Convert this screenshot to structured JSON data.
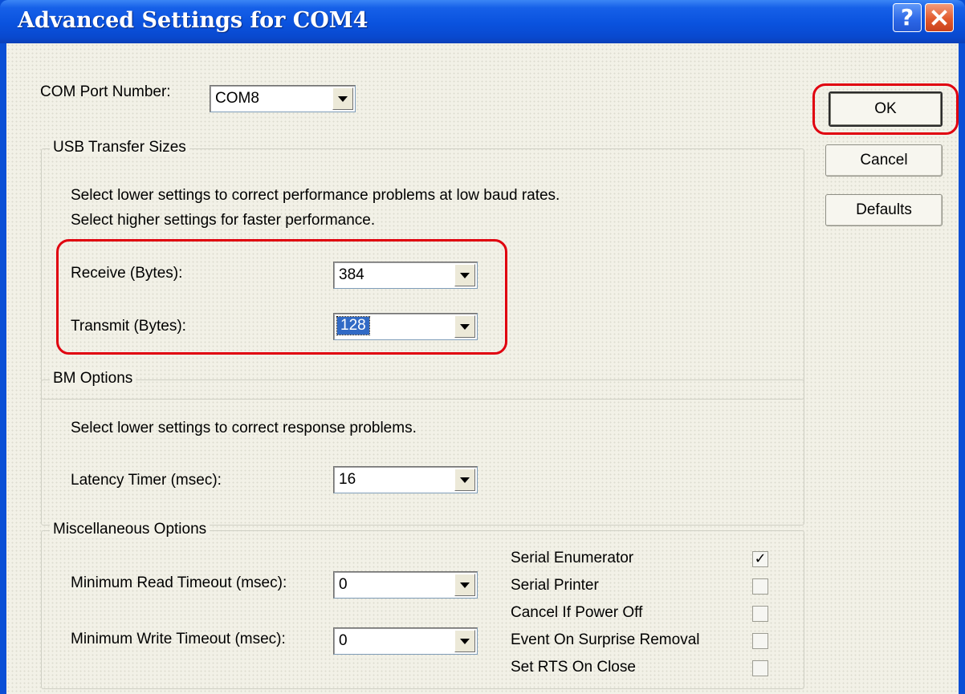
{
  "window": {
    "title": "Advanced Settings for COM4"
  },
  "com_port": {
    "label": "COM Port Number:",
    "value": "COM8"
  },
  "buttons": {
    "ok": "OK",
    "cancel": "Cancel",
    "defaults": "Defaults"
  },
  "usb_transfer": {
    "group_title": "USB Transfer Sizes",
    "hint_line1": "Select lower settings to correct performance problems at low baud rates.",
    "hint_line2": "Select higher settings for faster performance.",
    "receive_label": "Receive (Bytes):",
    "receive_value": "384",
    "transmit_label": "Transmit (Bytes):",
    "transmit_value": "128"
  },
  "bm_options": {
    "group_title": "BM Options",
    "hint": "Select lower settings to correct response problems.",
    "latency_label": "Latency Timer (msec):",
    "latency_value": "16"
  },
  "misc_options": {
    "group_title": "Miscellaneous Options",
    "min_read_label": "Minimum Read Timeout (msec):",
    "min_read_value": "0",
    "min_write_label": "Minimum Write Timeout (msec):",
    "min_write_value": "0",
    "checkboxes": [
      {
        "label": "Serial Enumerator",
        "checked": true
      },
      {
        "label": "Serial Printer",
        "checked": false
      },
      {
        "label": "Cancel If Power Off",
        "checked": false
      },
      {
        "label": "Event On Surprise Removal",
        "checked": false
      },
      {
        "label": "Set RTS On Close",
        "checked": false
      }
    ]
  },
  "colors": {
    "titlebar": "#0a52de",
    "dialog_background": "#f2f1e7",
    "selection": "#316ac5",
    "annotation": "#e0000f"
  },
  "icons": {
    "help": "help-icon",
    "close": "close-icon",
    "dropdown": "chevron-down-icon",
    "check": "check-icon"
  }
}
